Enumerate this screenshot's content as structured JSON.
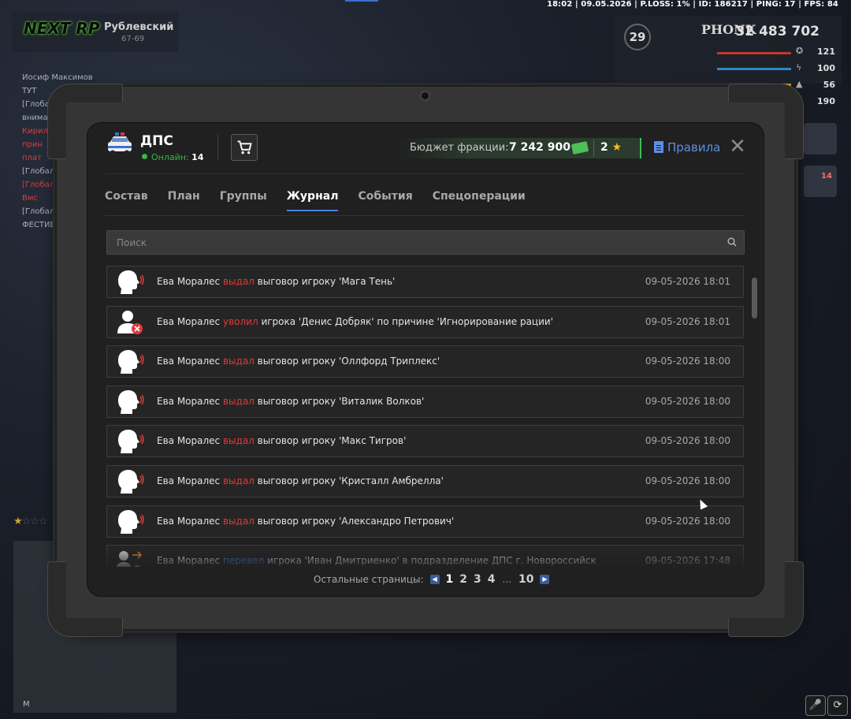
{
  "status_bar": {
    "text": "18:02 | 09.05.2026 | P.LOSS: 1% | ID: 186217 | PING: 17 | FPS: 84"
  },
  "hud_logo": {
    "brand": "NEXT RP",
    "server": "Рублевский",
    "server_sub": "67-69"
  },
  "chat_lines": [
    {
      "text": "Иосиф Максимов ТУТ",
      "color": "normal"
    },
    {
      "text": "[Глобальный]",
      "color": "normal"
    },
    {
      "text": "внима",
      "color": "normal"
    },
    {
      "text": "Кирил",
      "color": "red"
    },
    {
      "text": "прин",
      "color": "red"
    },
    {
      "text": "плат",
      "color": "red"
    },
    {
      "text": "[Глобал",
      "color": "normal"
    },
    {
      "text": "[Глобал",
      "color": "red"
    },
    {
      "text": "Вмс",
      "color": "red"
    },
    {
      "text": "[Глобал",
      "color": "normal"
    },
    {
      "text": "ФЕСТИВ",
      "color": "normal"
    }
  ],
  "hud_stats": {
    "level": "29",
    "nickname": "PHONK",
    "money": "32 483 702",
    "health": "121",
    "energy": "100",
    "hunger": "56",
    "armor": "190",
    "notifications": "14",
    "minimap_letter": "M"
  },
  "faction": {
    "name": "ДПС",
    "online_label": "Онлайн:",
    "online_count": "14",
    "budget_label": "Бюджет фракции:",
    "budget_value": "7 242 900",
    "stars": "2",
    "rules_label": "Правила"
  },
  "tabs": [
    {
      "label": "Состав",
      "active": false
    },
    {
      "label": "План",
      "active": false
    },
    {
      "label": "Группы",
      "active": false
    },
    {
      "label": "Журнал",
      "active": true
    },
    {
      "label": "События",
      "active": false
    },
    {
      "label": "Спецоперации",
      "active": false
    }
  ],
  "search": {
    "placeholder": "Поиск",
    "value": ""
  },
  "journal": [
    {
      "icon": "speaking-head-icon",
      "actor": "Ева Моралес",
      "action": "выдал",
      "action_color": "red",
      "rest": "выговор игроку 'Мага Тень'",
      "time": "09-05-2026 18:01"
    },
    {
      "icon": "user-remove-icon",
      "actor": "Ева Моралес",
      "action": "уволил",
      "action_color": "red",
      "rest": "игрока 'Денис Добряк' по причине 'Игнорирование рации'",
      "time": "09-05-2026 18:01"
    },
    {
      "icon": "speaking-head-icon",
      "actor": "Ева Моралес",
      "action": "выдал",
      "action_color": "red",
      "rest": "выговор игроку 'Оллфорд Триплекс'",
      "time": "09-05-2026 18:00"
    },
    {
      "icon": "speaking-head-icon",
      "actor": "Ева Моралес",
      "action": "выдал",
      "action_color": "red",
      "rest": "выговор игроку 'Виталик Волков'",
      "time": "09-05-2026 18:00"
    },
    {
      "icon": "speaking-head-icon",
      "actor": "Ева Моралес",
      "action": "выдал",
      "action_color": "red",
      "rest": "выговор игроку 'Макс Тигров'",
      "time": "09-05-2026 18:00"
    },
    {
      "icon": "speaking-head-icon",
      "actor": "Ева Моралес",
      "action": "выдал",
      "action_color": "red",
      "rest": "выговор игроку 'Кристалл Амбрелла'",
      "time": "09-05-2026 18:00"
    },
    {
      "icon": "speaking-head-icon",
      "actor": "Ева Моралес",
      "action": "выдал",
      "action_color": "red",
      "rest": "выговор игроку 'Александро Петрович'",
      "time": "09-05-2026 18:00"
    },
    {
      "icon": "user-transfer-icon",
      "actor": "Ева Моралес",
      "action": "перевел",
      "action_color": "blue",
      "rest": "игрока 'Иван Дмитриенко' в подразделение ДПС г. Новороссийск",
      "time": "09-05-2026 17:48"
    }
  ],
  "pagination": {
    "label": "Остальные страницы:",
    "pages": [
      "1",
      "2",
      "3",
      "4"
    ],
    "current": "1",
    "ellipsis": "...",
    "last": "10"
  },
  "colors": {
    "accent_blue": "#4a83e0",
    "action_red": "#e03a3a",
    "online_green": "#3ab54a",
    "star_gold": "#f0c020"
  }
}
